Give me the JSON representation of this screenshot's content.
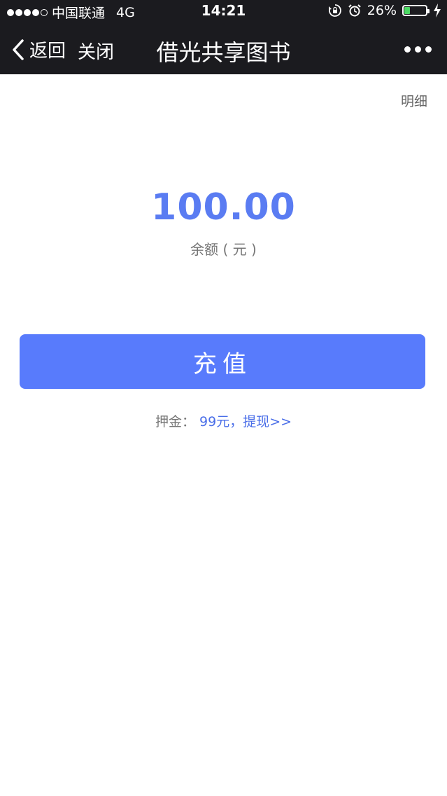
{
  "status_bar": {
    "carrier": "中国联通",
    "network": "4G",
    "time": "14:21",
    "battery_percent": "26%",
    "battery_level": 0.26
  },
  "nav": {
    "back_label": "返回",
    "close_label": "关闭",
    "title": "借光共享图书"
  },
  "main": {
    "detail_link": "明细",
    "balance_amount": "100.00",
    "balance_label": "余额 ( 元 )",
    "recharge_button": "充值",
    "deposit_label": "押金：",
    "deposit_link": "99元，提现>>"
  },
  "colors": {
    "accent": "#587bfc",
    "nav_bg": "#1b1b1f",
    "battery": "#4cd964"
  }
}
